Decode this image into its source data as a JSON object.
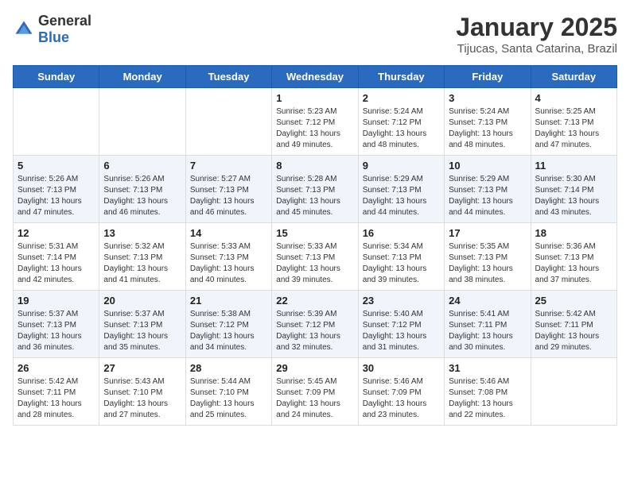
{
  "header": {
    "logo_general": "General",
    "logo_blue": "Blue",
    "month_year": "January 2025",
    "location": "Tijucas, Santa Catarina, Brazil"
  },
  "days_of_week": [
    "Sunday",
    "Monday",
    "Tuesday",
    "Wednesday",
    "Thursday",
    "Friday",
    "Saturday"
  ],
  "weeks": [
    [
      {
        "day": "",
        "sunrise": "",
        "sunset": "",
        "daylight": ""
      },
      {
        "day": "",
        "sunrise": "",
        "sunset": "",
        "daylight": ""
      },
      {
        "day": "",
        "sunrise": "",
        "sunset": "",
        "daylight": ""
      },
      {
        "day": "1",
        "sunrise": "Sunrise: 5:23 AM",
        "sunset": "Sunset: 7:12 PM",
        "daylight": "Daylight: 13 hours and 49 minutes."
      },
      {
        "day": "2",
        "sunrise": "Sunrise: 5:24 AM",
        "sunset": "Sunset: 7:12 PM",
        "daylight": "Daylight: 13 hours and 48 minutes."
      },
      {
        "day": "3",
        "sunrise": "Sunrise: 5:24 AM",
        "sunset": "Sunset: 7:13 PM",
        "daylight": "Daylight: 13 hours and 48 minutes."
      },
      {
        "day": "4",
        "sunrise": "Sunrise: 5:25 AM",
        "sunset": "Sunset: 7:13 PM",
        "daylight": "Daylight: 13 hours and 47 minutes."
      }
    ],
    [
      {
        "day": "5",
        "sunrise": "Sunrise: 5:26 AM",
        "sunset": "Sunset: 7:13 PM",
        "daylight": "Daylight: 13 hours and 47 minutes."
      },
      {
        "day": "6",
        "sunrise": "Sunrise: 5:26 AM",
        "sunset": "Sunset: 7:13 PM",
        "daylight": "Daylight: 13 hours and 46 minutes."
      },
      {
        "day": "7",
        "sunrise": "Sunrise: 5:27 AM",
        "sunset": "Sunset: 7:13 PM",
        "daylight": "Daylight: 13 hours and 46 minutes."
      },
      {
        "day": "8",
        "sunrise": "Sunrise: 5:28 AM",
        "sunset": "Sunset: 7:13 PM",
        "daylight": "Daylight: 13 hours and 45 minutes."
      },
      {
        "day": "9",
        "sunrise": "Sunrise: 5:29 AM",
        "sunset": "Sunset: 7:13 PM",
        "daylight": "Daylight: 13 hours and 44 minutes."
      },
      {
        "day": "10",
        "sunrise": "Sunrise: 5:29 AM",
        "sunset": "Sunset: 7:13 PM",
        "daylight": "Daylight: 13 hours and 44 minutes."
      },
      {
        "day": "11",
        "sunrise": "Sunrise: 5:30 AM",
        "sunset": "Sunset: 7:14 PM",
        "daylight": "Daylight: 13 hours and 43 minutes."
      }
    ],
    [
      {
        "day": "12",
        "sunrise": "Sunrise: 5:31 AM",
        "sunset": "Sunset: 7:14 PM",
        "daylight": "Daylight: 13 hours and 42 minutes."
      },
      {
        "day": "13",
        "sunrise": "Sunrise: 5:32 AM",
        "sunset": "Sunset: 7:13 PM",
        "daylight": "Daylight: 13 hours and 41 minutes."
      },
      {
        "day": "14",
        "sunrise": "Sunrise: 5:33 AM",
        "sunset": "Sunset: 7:13 PM",
        "daylight": "Daylight: 13 hours and 40 minutes."
      },
      {
        "day": "15",
        "sunrise": "Sunrise: 5:33 AM",
        "sunset": "Sunset: 7:13 PM",
        "daylight": "Daylight: 13 hours and 39 minutes."
      },
      {
        "day": "16",
        "sunrise": "Sunrise: 5:34 AM",
        "sunset": "Sunset: 7:13 PM",
        "daylight": "Daylight: 13 hours and 39 minutes."
      },
      {
        "day": "17",
        "sunrise": "Sunrise: 5:35 AM",
        "sunset": "Sunset: 7:13 PM",
        "daylight": "Daylight: 13 hours and 38 minutes."
      },
      {
        "day": "18",
        "sunrise": "Sunrise: 5:36 AM",
        "sunset": "Sunset: 7:13 PM",
        "daylight": "Daylight: 13 hours and 37 minutes."
      }
    ],
    [
      {
        "day": "19",
        "sunrise": "Sunrise: 5:37 AM",
        "sunset": "Sunset: 7:13 PM",
        "daylight": "Daylight: 13 hours and 36 minutes."
      },
      {
        "day": "20",
        "sunrise": "Sunrise: 5:37 AM",
        "sunset": "Sunset: 7:13 PM",
        "daylight": "Daylight: 13 hours and 35 minutes."
      },
      {
        "day": "21",
        "sunrise": "Sunrise: 5:38 AM",
        "sunset": "Sunset: 7:12 PM",
        "daylight": "Daylight: 13 hours and 34 minutes."
      },
      {
        "day": "22",
        "sunrise": "Sunrise: 5:39 AM",
        "sunset": "Sunset: 7:12 PM",
        "daylight": "Daylight: 13 hours and 32 minutes."
      },
      {
        "day": "23",
        "sunrise": "Sunrise: 5:40 AM",
        "sunset": "Sunset: 7:12 PM",
        "daylight": "Daylight: 13 hours and 31 minutes."
      },
      {
        "day": "24",
        "sunrise": "Sunrise: 5:41 AM",
        "sunset": "Sunset: 7:11 PM",
        "daylight": "Daylight: 13 hours and 30 minutes."
      },
      {
        "day": "25",
        "sunrise": "Sunrise: 5:42 AM",
        "sunset": "Sunset: 7:11 PM",
        "daylight": "Daylight: 13 hours and 29 minutes."
      }
    ],
    [
      {
        "day": "26",
        "sunrise": "Sunrise: 5:42 AM",
        "sunset": "Sunset: 7:11 PM",
        "daylight": "Daylight: 13 hours and 28 minutes."
      },
      {
        "day": "27",
        "sunrise": "Sunrise: 5:43 AM",
        "sunset": "Sunset: 7:10 PM",
        "daylight": "Daylight: 13 hours and 27 minutes."
      },
      {
        "day": "28",
        "sunrise": "Sunrise: 5:44 AM",
        "sunset": "Sunset: 7:10 PM",
        "daylight": "Daylight: 13 hours and 25 minutes."
      },
      {
        "day": "29",
        "sunrise": "Sunrise: 5:45 AM",
        "sunset": "Sunset: 7:09 PM",
        "daylight": "Daylight: 13 hours and 24 minutes."
      },
      {
        "day": "30",
        "sunrise": "Sunrise: 5:46 AM",
        "sunset": "Sunset: 7:09 PM",
        "daylight": "Daylight: 13 hours and 23 minutes."
      },
      {
        "day": "31",
        "sunrise": "Sunrise: 5:46 AM",
        "sunset": "Sunset: 7:08 PM",
        "daylight": "Daylight: 13 hours and 22 minutes."
      },
      {
        "day": "",
        "sunrise": "",
        "sunset": "",
        "daylight": ""
      }
    ]
  ]
}
